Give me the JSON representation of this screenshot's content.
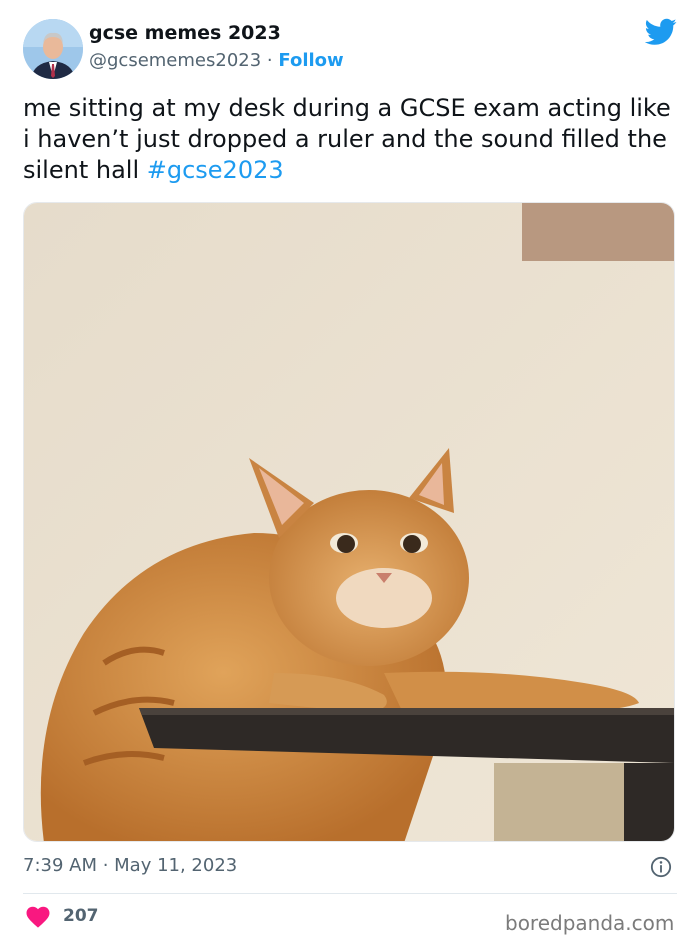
{
  "author": {
    "display_name": "gcse memes 2023",
    "handle": "@gcsememes2023",
    "separator": "·",
    "follow_label": "Follow"
  },
  "tweet": {
    "text": "me sitting at my desk during a GCSE exam acting like i haven’t just dropped a ruler and the sound filled the silent hall",
    "hashtag": "#gcse2023",
    "timestamp": "7:39 AM · May 11, 2023",
    "likes": "207"
  },
  "media": {
    "description_icon": "photo"
  },
  "icons": {
    "brand": "twitter-bird-icon",
    "info": "info-icon",
    "like": "heart-icon"
  },
  "colors": {
    "accent": "#1d9bf0",
    "heart": "#f91880",
    "secondary_text": "#536471"
  },
  "watermark": "boredpanda.com"
}
